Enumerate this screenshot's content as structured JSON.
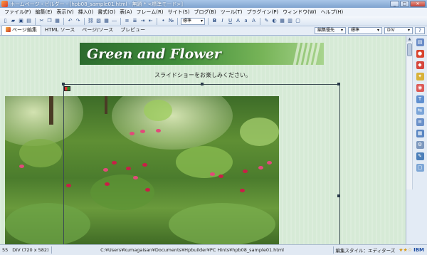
{
  "window": {
    "title": "ホームページ・ビルダー - [hpb08_sample01.html - 無題 * <標準モード>]",
    "controls": {
      "minimize": "_",
      "maximize": "□",
      "close": "✕"
    }
  },
  "menu": {
    "items": [
      "ファイル(F)",
      "編集(E)",
      "表示(V)",
      "挿入(I)",
      "書式(O)",
      "表(A)",
      "フレーム(R)",
      "サイト(S)",
      "ブログ(B)",
      "ツール(T)",
      "プラグイン(P)",
      "ウィンドウ(W)",
      "ヘルプ(H)"
    ]
  },
  "toolbar": {
    "paragraph_select": "標準",
    "bold": "B",
    "italic": "I",
    "underline": "U"
  },
  "tabs": {
    "items": [
      "ページ編集",
      "HTML ソース",
      "ページ/ソース",
      "プレビュー"
    ],
    "active_index": 0
  },
  "style_selectors": {
    "edit_priority": "編集優先",
    "style": "標準",
    "element": "DIV"
  },
  "page": {
    "banner_title": "Green and Flower",
    "subtitle": "スライドショーをお楽しみください。"
  },
  "colors": {
    "banner_dark": "#2c6b2e",
    "banner_light": "#a8d48e",
    "page_background": "#d6ead6",
    "selection_frame": "#3b4b52"
  },
  "status": {
    "line": "55",
    "element": "DIV (720 x 582)",
    "path": "C:¥Users¥kumagaisan¥Documents¥Hpbuilder¥PC Hints¥hpb08_sample01.html",
    "edit_style": "編集スタイル：エディターズ",
    "rating": "★★☆",
    "brand": "IBM"
  },
  "side_icons": [
    "page-icon",
    "globe-icon",
    "image-icon",
    "clip-icon",
    "color-icon",
    "text-icon",
    "link-icon",
    "list-icon",
    "table-icon",
    "gear-icon",
    "tool-icon",
    "frame-icon"
  ]
}
